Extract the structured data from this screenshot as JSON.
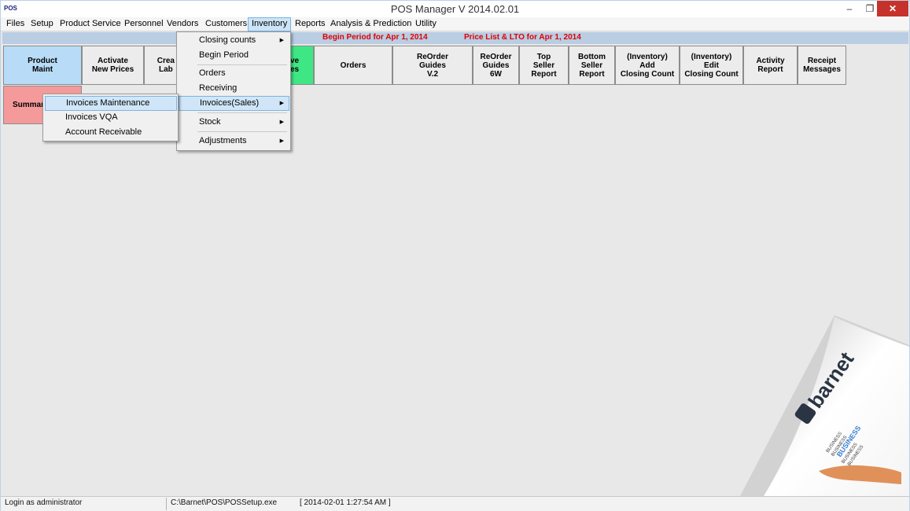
{
  "window": {
    "app_icon": "POS",
    "title": "POS Manager V 2014.02.01",
    "minimize": "–",
    "maximize": "❐",
    "close": "✕"
  },
  "menubar": [
    "Files",
    "Setup",
    "Product Service",
    "Personnel",
    "Vendors",
    "Customers",
    "Inventory",
    "Reports",
    "Analysis & Prediction",
    "Utility"
  ],
  "info": {
    "begin_period": "Begin Period for  Apr 1, 2014",
    "price_list": "Price List & LTO for  Apr 1, 2014",
    "color": "#e00000"
  },
  "toolbar": [
    {
      "label": "Product\nMaint",
      "color": "#b8dcf7"
    },
    {
      "label": "Activate\nNew Prices",
      "color": "#ececec"
    },
    {
      "label": "Crea\nLab",
      "color": "#ececec"
    },
    {
      "label": "ve\nes",
      "color": "#3fe784"
    },
    {
      "label": "Orders",
      "color": "#ececec"
    },
    {
      "label": "ReOrder\nGuides\nV.2",
      "color": "#ececec"
    },
    {
      "label": "ReOrder\nGuides\n6W",
      "color": "#ececec"
    },
    {
      "label": "Top\nSeller\nReport",
      "color": "#ececec"
    },
    {
      "label": "Bottom\nSeller\nReport",
      "color": "#ececec"
    },
    {
      "label": "(Inventory)\nAdd\nClosing Count",
      "color": "#ececec"
    },
    {
      "label": "(Inventory)\nEdit\nClosing Count",
      "color": "#ececec"
    },
    {
      "label": "Activity\nReport",
      "color": "#ececec"
    },
    {
      "label": "Receipt\nMessages",
      "color": "#ececec"
    }
  ],
  "summary_button": {
    "label": "Summar",
    "color": "#f59a9a"
  },
  "inventory_menu": [
    {
      "label": "Closing  counts",
      "submenu": true
    },
    {
      "label": "Begin Period",
      "submenu": false
    },
    {
      "label": "Orders",
      "submenu": false
    },
    {
      "label": "Receiving",
      "submenu": false
    },
    {
      "label": "Invoices(Sales)",
      "submenu": true,
      "highlighted": true
    },
    {
      "label": "Stock",
      "submenu": true
    },
    {
      "label": "Adjustments",
      "submenu": true
    }
  ],
  "invoices_submenu": [
    {
      "label": "Invoices Maintenance",
      "highlighted": true
    },
    {
      "label": "Invoices VQA"
    },
    {
      "label": "Account Receivable"
    }
  ],
  "logo": {
    "brand": "barnet",
    "words": [
      "BUSINESS",
      "BUSINESS",
      "BUSINESS",
      "BUSINESS",
      "BUSINESS"
    ]
  },
  "status": {
    "login": "Login as administrator",
    "path": "C:\\Barnet\\POS\\POSSetup.exe",
    "datetime": "[  2014-02-01 1:27:54 AM  ]"
  }
}
